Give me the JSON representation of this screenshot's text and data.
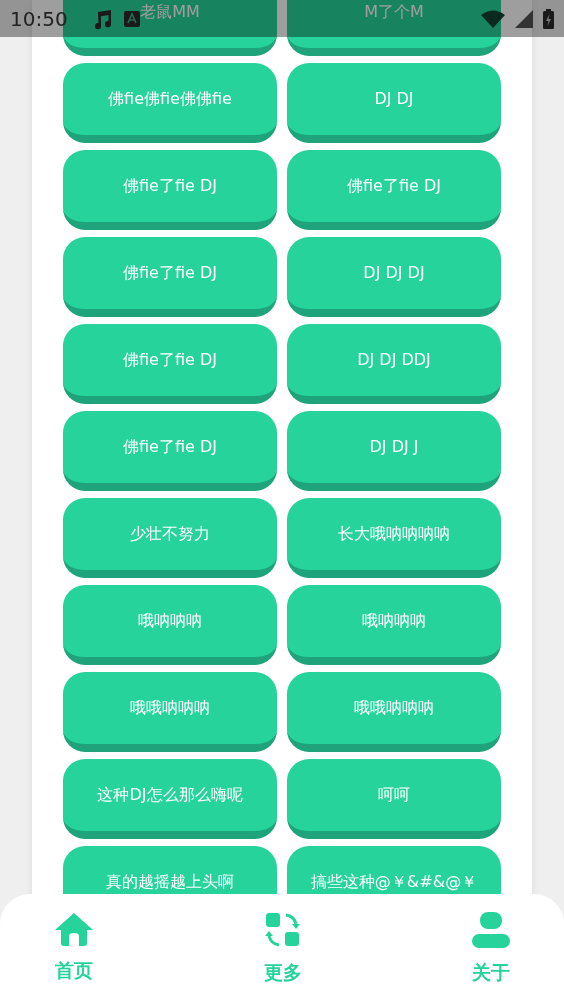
{
  "status_bar": {
    "time": "10:50"
  },
  "buttons": [
    {
      "label": "老鼠MM"
    },
    {
      "label": "M了个M"
    },
    {
      "label": "佛fie佛fie佛佛fie"
    },
    {
      "label": "DJ DJ"
    },
    {
      "label": "佛fie了fie DJ"
    },
    {
      "label": "佛fie了fie DJ"
    },
    {
      "label": "佛fie了fie DJ"
    },
    {
      "label": "DJ DJ DJ"
    },
    {
      "label": "佛fie了fie DJ"
    },
    {
      "label": "DJ DJ DDJ"
    },
    {
      "label": "佛fie了fie DJ"
    },
    {
      "label": "DJ DJ J"
    },
    {
      "label": "少壮不努力"
    },
    {
      "label": "长大哦呐呐呐呐"
    },
    {
      "label": "哦呐呐呐"
    },
    {
      "label": "哦呐呐呐"
    },
    {
      "label": "哦哦呐呐呐"
    },
    {
      "label": "哦哦呐呐呐"
    },
    {
      "label": "这种DJ怎么那么嗨呢"
    },
    {
      "label": "呵呵"
    },
    {
      "label": "真的越摇越上头啊"
    },
    {
      "label": "搞些这种@￥&#&@￥"
    }
  ],
  "bottom_nav": [
    {
      "label": "首页"
    },
    {
      "label": "更多"
    },
    {
      "label": "关于"
    }
  ]
}
